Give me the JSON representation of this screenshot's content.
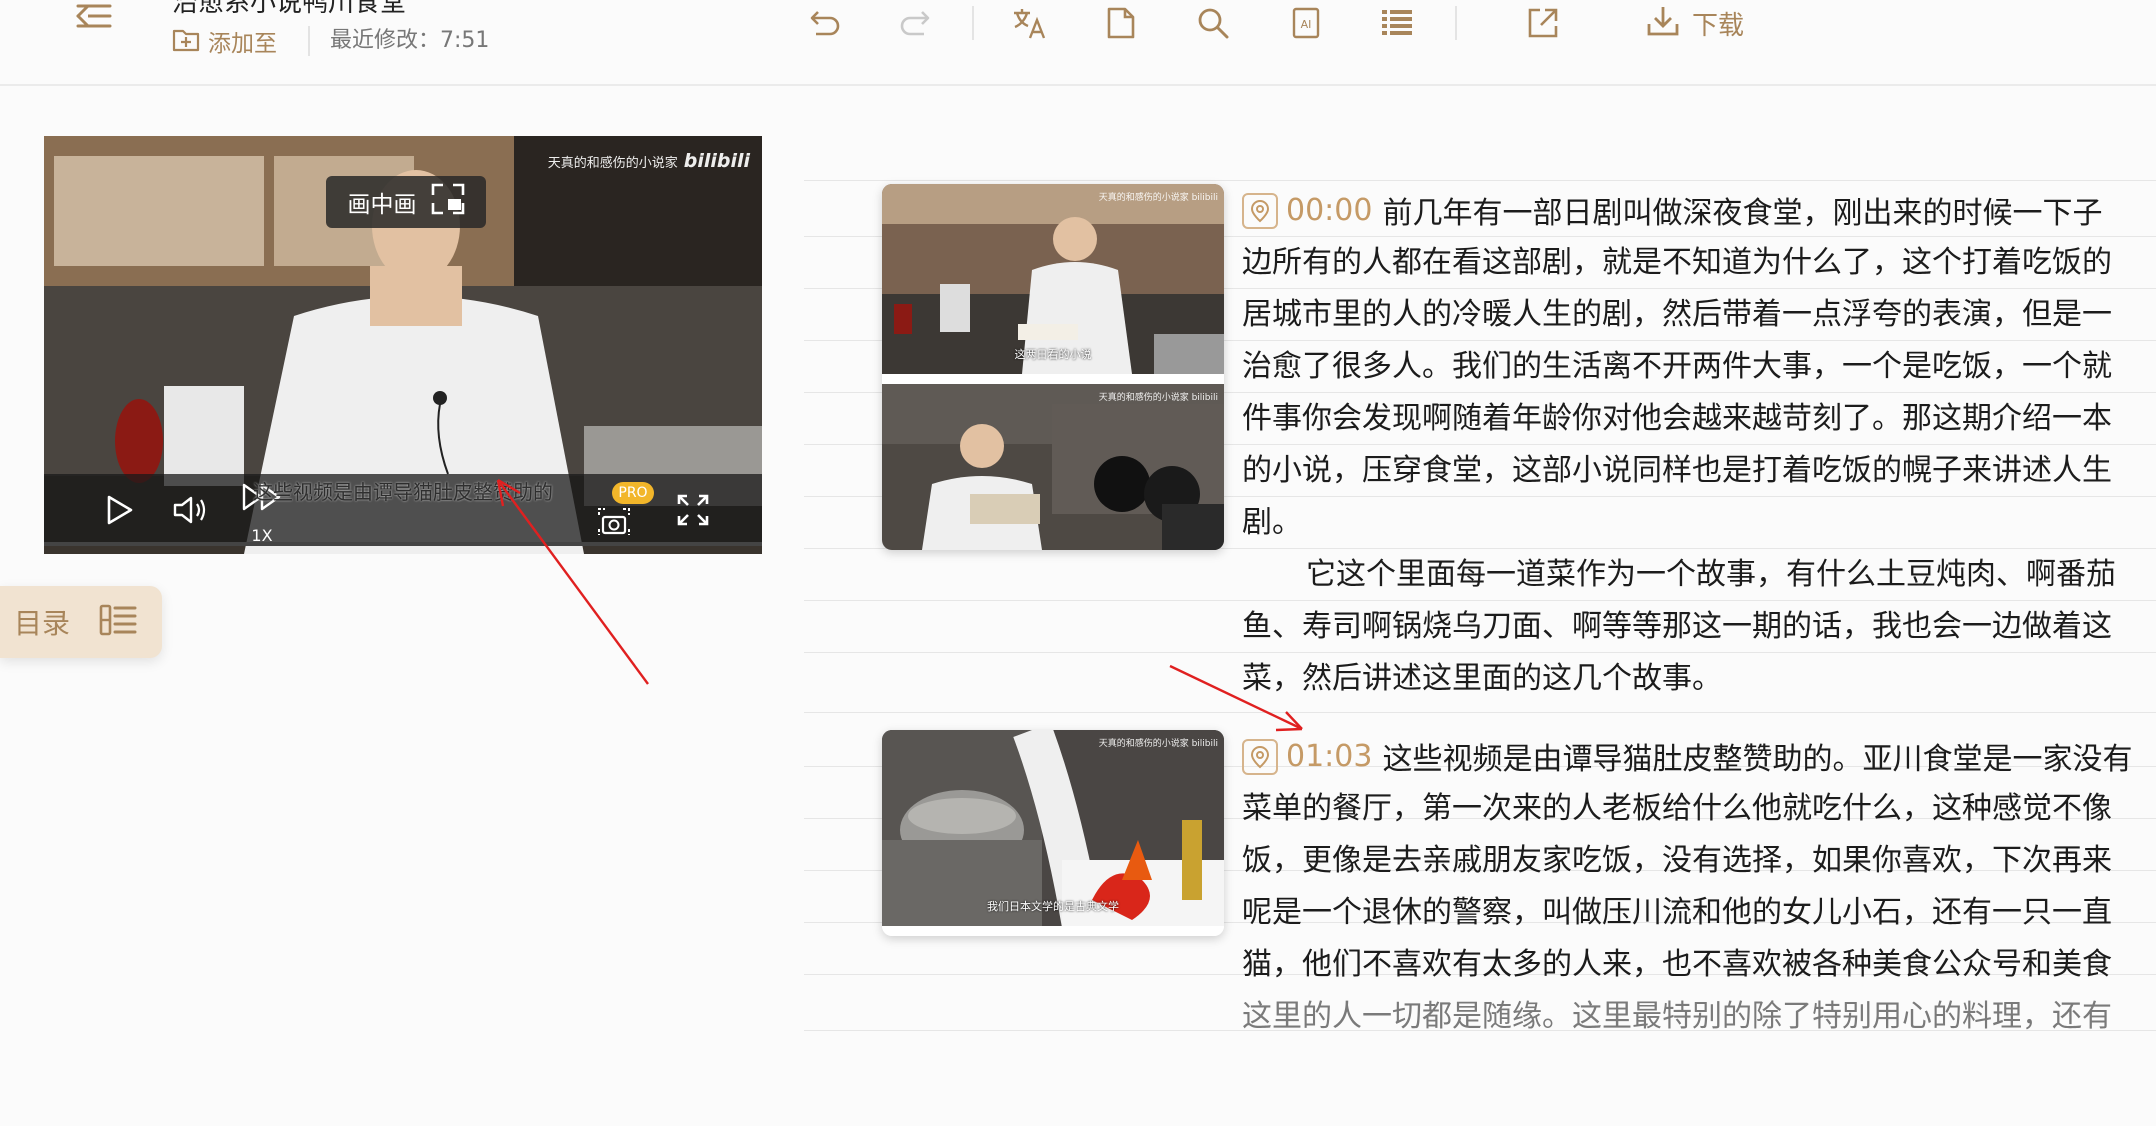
{
  "header": {
    "title": "治愈系小说鸭川食堂",
    "add_to_label": "添加至",
    "last_modified": "最近修改：7:51",
    "toolbar": {
      "icons": [
        "undo-icon",
        "redo-icon",
        "translate-icon",
        "document-icon",
        "search-icon",
        "ai-icon",
        "outline-list-icon",
        "export-icon",
        "download-icon"
      ],
      "download_label": "下载"
    }
  },
  "player": {
    "pip_label": "画中画",
    "watermark_channel": "天真的和感伤的小说家",
    "watermark_logo": "bilibili",
    "subtitle": "这些视频是由谭导猫肚皮整赞助的",
    "speed": "1X",
    "pro_badge": "PRO",
    "progress": 0.0
  },
  "toc": {
    "label": "目录"
  },
  "transcript": [
    {
      "timestamp": "00:00",
      "lines": [
        "前几年有一部日剧叫做深夜食堂，刚出来的时候一下子",
        "边所有的人都在看这部剧，就是不知道为什么了，这个打着吃饭的",
        "居城市里的人的冷暖人生的剧，然后带着一点浮夸的表演，但是一",
        "治愈了很多人。我们的生活离不开两件大事，一个是吃饭，一个就",
        "件事你会发现啊随着年龄你对他会越来越苛刻了。那这期介绍一本",
        "的小说，压穿食堂，这部小说同样也是打着吃饭的幌子来讲述人生",
        "剧。"
      ]
    },
    {
      "timestamp": "",
      "lines": [
        "它这个里面每一道菜作为一个故事，有什么土豆炖肉、啊番茄",
        "鱼、寿司啊锅烧乌刀面、啊等等那这一期的话，我也会一边做着这",
        "菜，然后讲述这里面的这几个故事。"
      ]
    },
    {
      "timestamp": "01:03",
      "lines": [
        "这些视频是由谭导猫肚皮整赞助的。亚川食堂是一家没有",
        "菜单的餐厅，第一次来的人老板给什么他就吃什么，这种感觉不像",
        "饭，更像是去亲戚朋友家吃饭，没有选择，如果你喜欢，下次再来",
        "呢是一个退休的警察，叫做压川流和他的女儿小石，还有一只一直",
        "猫，他们不喜欢有太多的人来，也不喜欢被各种美食公众号和美食",
        "这里的人一切都是随缘。这里最特别的除了特别用心的料理，还有"
      ]
    }
  ],
  "thumbnails": [
    {
      "caption": "这两日看的小说",
      "watermark": "天真的和感伤的小说家 bilibili"
    },
    {
      "caption": "",
      "watermark": "天真的和感伤的小说家 bilibili"
    },
    {
      "caption": "我们日本文学的是古典文学",
      "watermark": "天真的和感伤的小说家 bilibili"
    }
  ],
  "colors": {
    "accent": "#a8855a",
    "timestamp": "#c59a66",
    "annotation_arrow": "#e02020"
  }
}
